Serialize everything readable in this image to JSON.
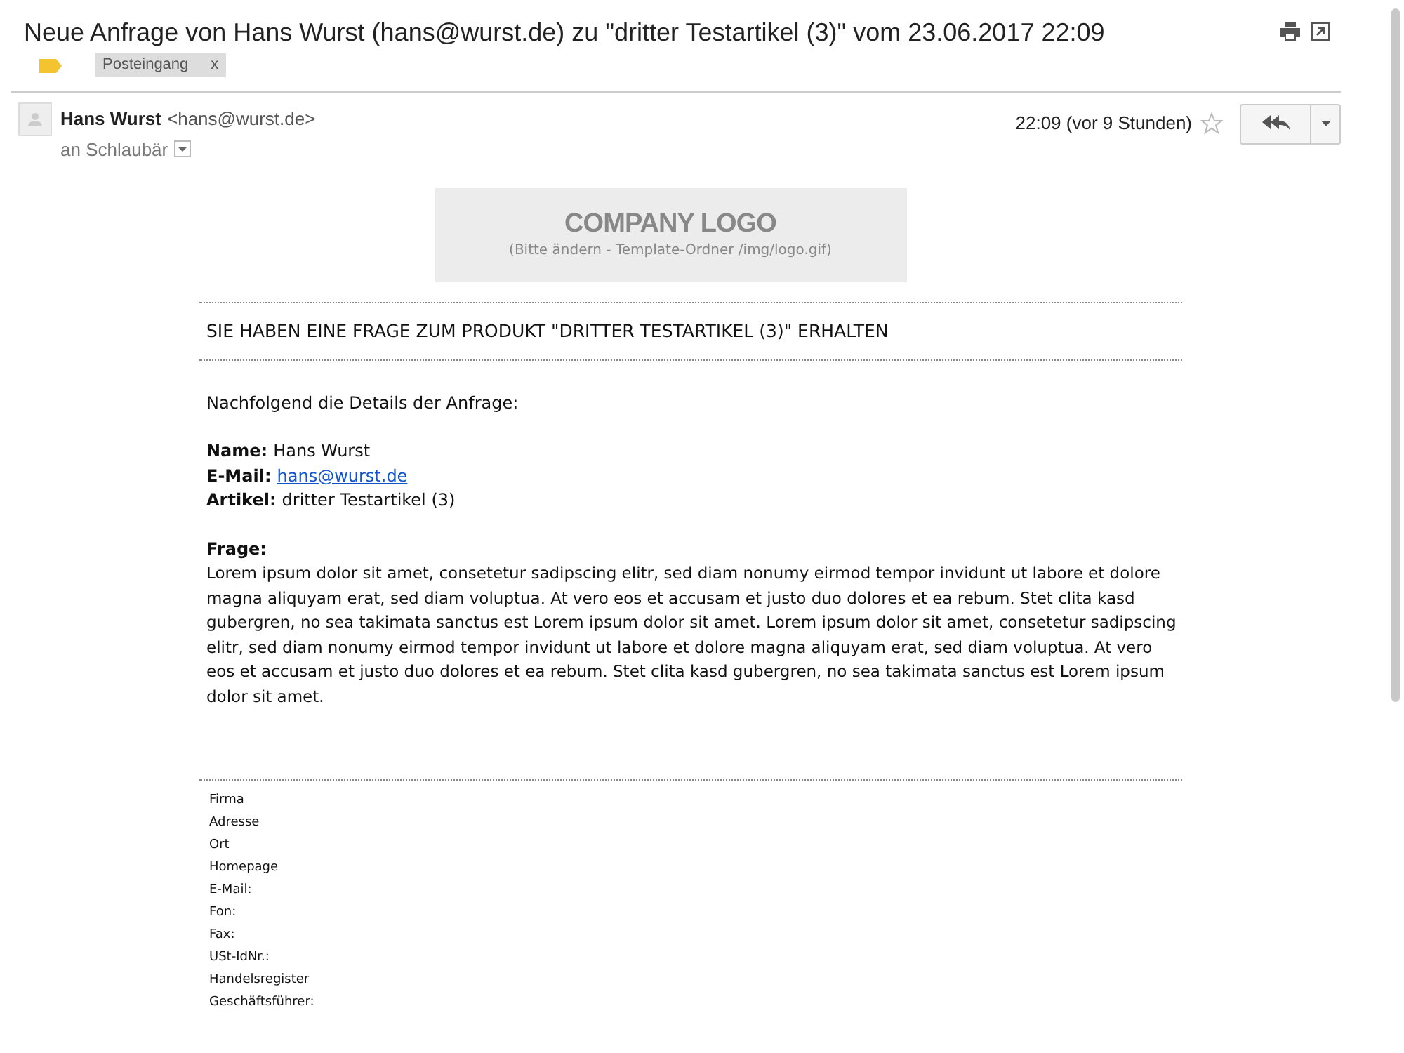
{
  "subject": "Neue Anfrage von Hans Wurst (hans@wurst.de) zu \"dritter Testartikel (3)\" vom 23.06.2017 22:09",
  "label": {
    "text": "Posteingang",
    "remove": "x"
  },
  "message": {
    "sender_name": "Hans Wurst",
    "sender_email": "<hans@wurst.de>",
    "recipient": "an Schlaubär",
    "time": "22:09 (vor 9 Stunden)",
    "starred": false
  },
  "logo": {
    "title": "COMPANY LOGO",
    "subtitle": "(Bitte ändern - Template-Ordner /img/logo.gif)"
  },
  "heading": "SIE HABEN EINE FRAGE ZUM PRODUKT \"DRITTER TESTARTIKEL (3)\" ERHALTEN",
  "intro": "Nachfolgend die Details der Anfrage:",
  "fields": [
    {
      "label": "Name:",
      "value": "Hans Wurst",
      "kind": "text"
    },
    {
      "label": "E-Mail:",
      "value": "hans@wurst.de",
      "kind": "link"
    },
    {
      "label": "Artikel:",
      "value": "dritter Testartikel (3)",
      "kind": "text"
    }
  ],
  "question_label": "Frage:",
  "question": "Lorem ipsum dolor sit amet, consetetur sadipscing elitr, sed diam nonumy eirmod tempor invidunt ut labore et dolore magna aliquyam erat, sed diam voluptua. At vero eos et accusam et justo duo dolores et ea rebum. Stet clita kasd gubergren, no sea takimata sanctus est Lorem ipsum dolor sit amet. Lorem ipsum dolor sit amet, consetetur sadipscing elitr, sed diam nonumy eirmod tempor invidunt ut labore et dolore magna aliquyam erat, sed diam voluptua. At vero eos et accusam et justo duo dolores et ea rebum. Stet clita kasd gubergren, no sea takimata sanctus est Lorem ipsum dolor sit amet.",
  "footer": [
    "Firma",
    "Adresse",
    "Ort",
    "Homepage",
    "E-Mail:",
    "Fon:",
    "Fax:",
    "USt-IdNr.:",
    "Handelsregister",
    "Geschäftsführer:"
  ]
}
